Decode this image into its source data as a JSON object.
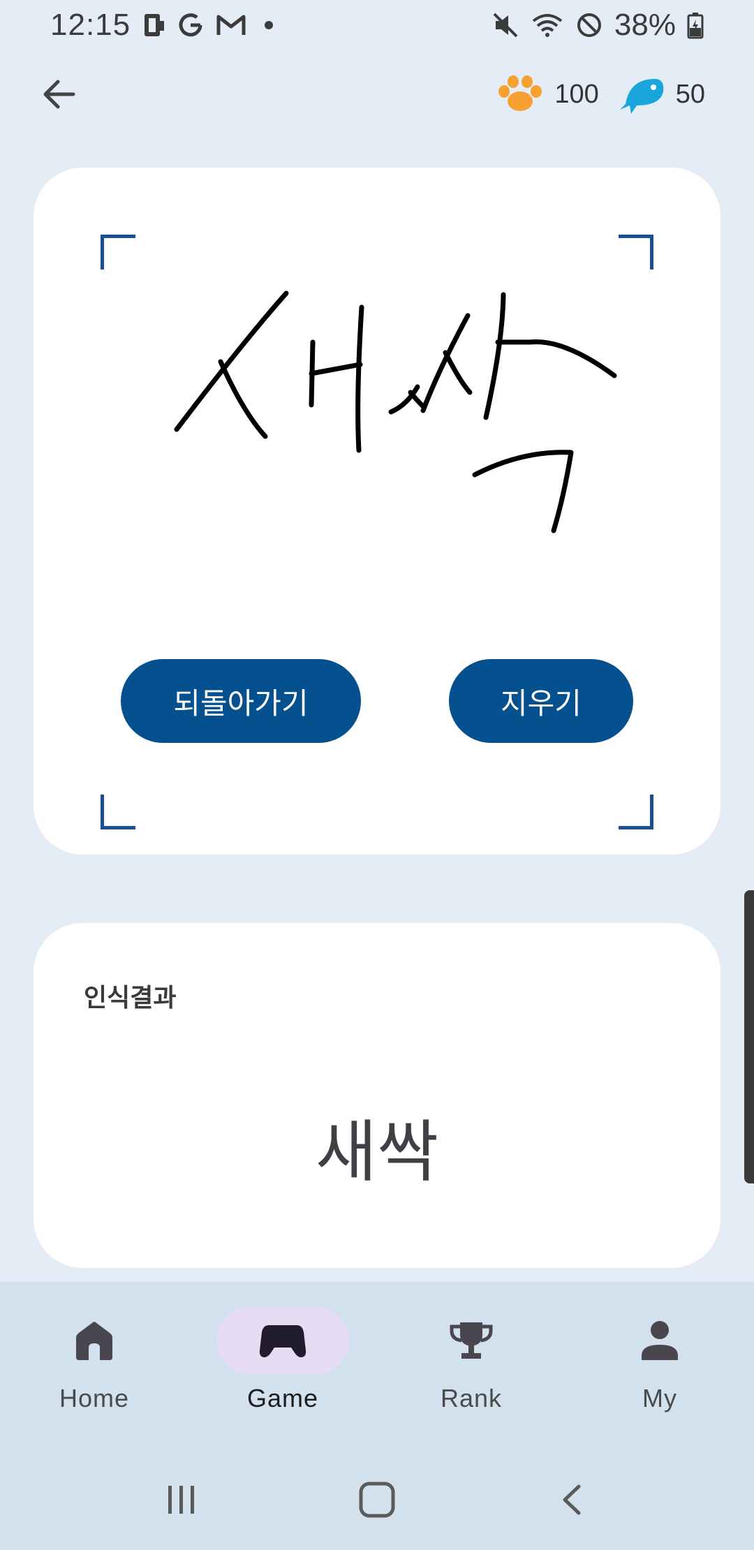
{
  "status_bar": {
    "time": "12:15",
    "battery": "38%"
  },
  "currency": {
    "paw_count": "100",
    "fish_count": "50",
    "paw_color": "#f7a133",
    "fish_color": "#1aa6dc"
  },
  "drawing": {
    "undo_label": "되돌아가기",
    "clear_label": "지우기",
    "accent_color": "#05508f"
  },
  "result": {
    "label": "인식결과",
    "text": "새싹"
  },
  "bottom_nav": {
    "items": [
      {
        "label": "Home",
        "icon": "home-icon",
        "active": false
      },
      {
        "label": "Game",
        "icon": "gamepad-icon",
        "active": true
      },
      {
        "label": "Rank",
        "icon": "trophy-icon",
        "active": false
      },
      {
        "label": "My",
        "icon": "person-icon",
        "active": false
      }
    ]
  }
}
